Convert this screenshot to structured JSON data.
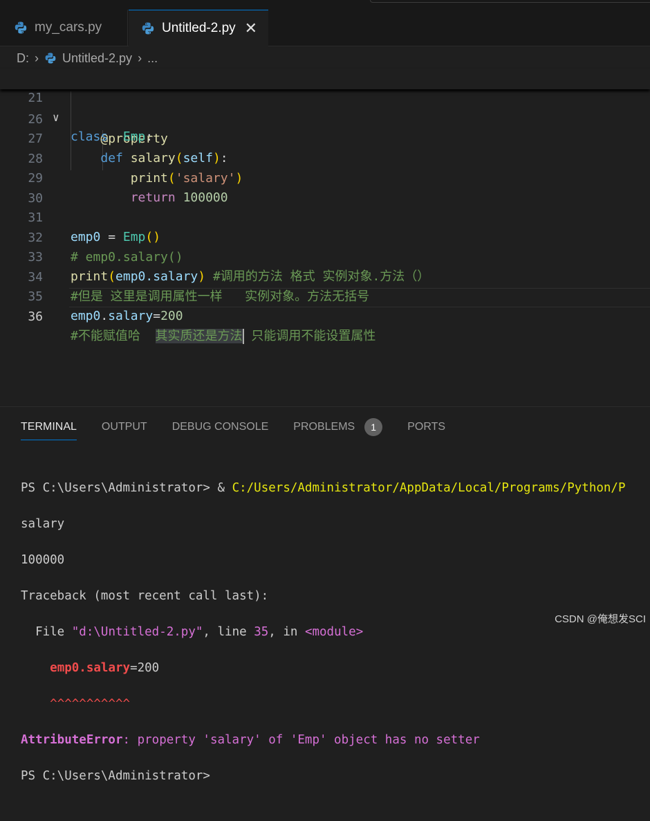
{
  "tabs": [
    {
      "label": "my_cars.py",
      "active": false
    },
    {
      "label": "Untitled-2.py",
      "active": true,
      "close": "✕"
    }
  ],
  "breadcrumb": {
    "drive": "D:",
    "file": "Untitled-2.py",
    "more": "..."
  },
  "editor": {
    "sticky": {
      "num": "21",
      "kw": "class",
      "name": "Emp",
      "colon": ":"
    },
    "line_numbers": [
      "26",
      "27",
      "28",
      "29",
      "30",
      "31",
      "32",
      "33",
      "34",
      "35",
      "36"
    ],
    "l26": "property",
    "l27": {
      "kw": "def",
      "fn": "salary",
      "param": "self"
    },
    "l28": {
      "fn": "print",
      "str": "'salary'"
    },
    "l29": {
      "kw": "return",
      "num": "100000"
    },
    "l31": {
      "var": "emp0",
      "op": " = ",
      "cls": "Emp"
    },
    "l32": "# emp0.salary()",
    "l33": {
      "fn": "print",
      "arg": "emp0.salary",
      "comment": "#调用的方法 格式 实例对象.方法（）"
    },
    "l34": "#但是 这里是调用属性一样   实例对象。方法无括号",
    "l35": {
      "var": "emp0",
      "attr": "salary",
      "num": "200"
    },
    "l36": {
      "pre": "#不能赋值哈  ",
      "selected": "其实质还是方法",
      "post": " 只能调用不能设置属性"
    }
  },
  "panel": {
    "tabs": [
      "TERMINAL",
      "OUTPUT",
      "DEBUG CONSOLE",
      "PROBLEMS",
      "PORTS"
    ],
    "problems_count": "1",
    "terminal": {
      "prompt1": "PS C:\\Users\\Administrator> ",
      "amp": "& ",
      "cmd": "C:/Users/Administrator/AppData/Local/Programs/Python/P",
      "out1": "salary",
      "out2": "100000",
      "tb_head": "Traceback (most recent call last):",
      "file_pre": "  File ",
      "file_path": "\"d:\\Untitled-2.py\"",
      "file_mid": ", line ",
      "file_line": "35",
      "file_in": ", in ",
      "file_mod": "<module>",
      "err_code_a": "emp0.salary",
      "err_code_b": "=200",
      "err_carets": "^^^^^^^^^^^",
      "err_type": "AttributeError",
      "err_msg": ": property 'salary' of 'Emp' object has no setter",
      "prompt2": "PS C:\\Users\\Administrator>"
    }
  },
  "watermark": "CSDN @俺想发SCI"
}
